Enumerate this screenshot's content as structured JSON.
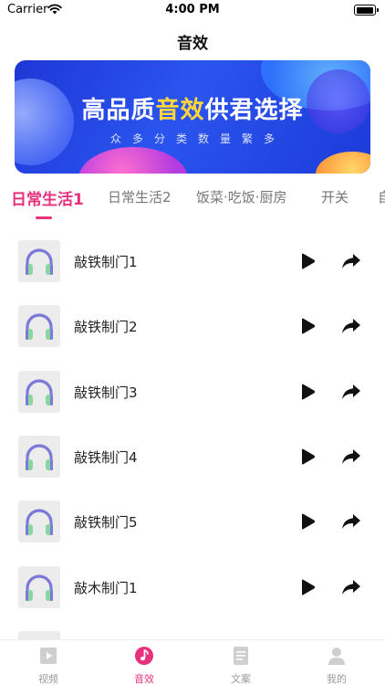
{
  "status_bar": {
    "carrier": "Carrier",
    "time": "4:00 PM"
  },
  "nav": {
    "title": "音效"
  },
  "banner": {
    "title_pre": "高品质",
    "title_highlight": "音效",
    "title_post": "供君选择",
    "subtitle": "众多分类数量繁多"
  },
  "tabs": [
    {
      "label": "日常生活1",
      "active": true
    },
    {
      "label": "日常生活2",
      "active": false
    },
    {
      "label": "饭菜·吃饭·厨房",
      "active": false
    },
    {
      "label": "开关",
      "active": false
    },
    {
      "label": "自",
      "active": false
    }
  ],
  "sounds": [
    {
      "title": "敲铁制门1"
    },
    {
      "title": "敲铁制门2"
    },
    {
      "title": "敲铁制门3"
    },
    {
      "title": "敲铁制门4"
    },
    {
      "title": "敲铁制门5"
    },
    {
      "title": "敲木制门1"
    },
    {
      "title": ""
    }
  ],
  "tabbar": [
    {
      "label": "视频",
      "icon": "video-icon",
      "active": false
    },
    {
      "label": "音效",
      "icon": "music-note-icon",
      "active": true
    },
    {
      "label": "文案",
      "icon": "document-icon",
      "active": false
    },
    {
      "label": "我的",
      "icon": "profile-icon",
      "active": false
    }
  ],
  "colors": {
    "accent": "#e8307e",
    "banner_blue": "#2b54ee",
    "banner_highlight": "#ffd73a",
    "headphone_purple": "#7c79d8",
    "headphone_green": "#8ad6a3"
  }
}
